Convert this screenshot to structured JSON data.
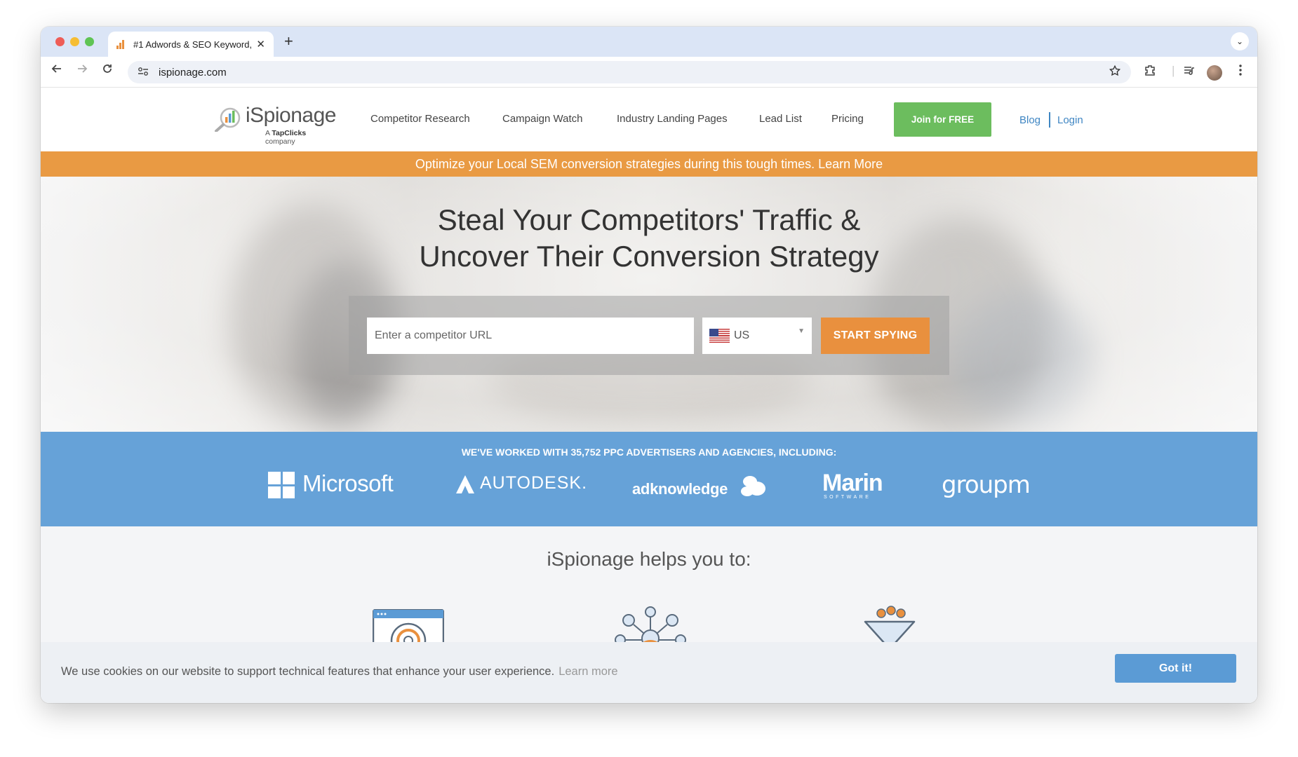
{
  "browser": {
    "tab_title": "#1 Adwords & SEO Keyword,",
    "tab_close": "✕",
    "new_tab": "+",
    "tab_menu": "⌄",
    "url": "ispionage.com",
    "icons": [
      "back-icon",
      "forward-icon",
      "reload-icon",
      "site-info-icon",
      "bookmark-star-icon",
      "extensions-icon",
      "media-icon",
      "profile-avatar",
      "menu-icon"
    ]
  },
  "header": {
    "logo_text": "iSpionage",
    "logo_sub_prefix": "A ",
    "logo_sub_brand": "TapClicks",
    "logo_sub_suffix": " company",
    "nav": [
      "Competitor Research",
      "Campaign Watch",
      "Industry Landing Pages",
      "Lead List",
      "Pricing"
    ],
    "join_label": "Join for FREE",
    "blog_label": "Blog",
    "login_label": "Login"
  },
  "promo": {
    "text": "Optimize your Local SEM conversion strategies during this tough times. Learn More"
  },
  "hero": {
    "title_line1": "Steal Your Competitors' Traffic &",
    "title_line2": "Uncover Their Conversion Strategy",
    "url_placeholder": "Enter a competitor URL",
    "country": "US",
    "spy_label": "START SPYING"
  },
  "clients": {
    "headline": "WE'VE WORKED WITH 35,752 PPC ADVERTISERS AND AGENCIES, INCLUDING:",
    "logos": [
      "Microsoft",
      "AUTODESK.",
      "adknowledge",
      "Marin",
      "SOFTWARE",
      "groupm"
    ]
  },
  "helps": {
    "title": "iSpionage helps you to:"
  },
  "cookie": {
    "text": "We use cookies on our website to support technical features that enhance your user experience.",
    "link": "Learn more",
    "button": "Got it!"
  },
  "colors": {
    "accent_orange": "#e9903e",
    "join_green": "#6cbd5e",
    "clients_blue": "#66a2d8",
    "link_blue": "#3f86c3"
  }
}
